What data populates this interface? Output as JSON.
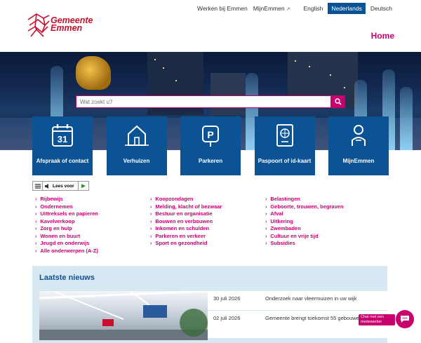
{
  "header": {
    "logo_line1": "Gemeente",
    "logo_line2": "Emmen",
    "links": {
      "werken": "Werken bij Emmen",
      "mijn": "MijnEmmen"
    },
    "languages": [
      "English",
      "Nederlands",
      "Deutsch"
    ],
    "active_language": "Nederlands",
    "home": "Home"
  },
  "search": {
    "placeholder": "Wat zoekt u?"
  },
  "tiles": [
    {
      "label": "Afspraak of contact",
      "icon": "calendar-icon",
      "icon_text": "31"
    },
    {
      "label": "Verhuizen",
      "icon": "house-icon"
    },
    {
      "label": "Parkeren",
      "icon": "parking-icon",
      "icon_text": "P"
    },
    {
      "label": "Paspoort of id-kaart",
      "icon": "passport-icon"
    },
    {
      "label": "MijnEmmen",
      "icon": "person-icon"
    }
  ],
  "reader": {
    "label": "Lees voor"
  },
  "links": {
    "col1": [
      "Rijbewijs",
      "Ondernemen",
      "Uittreksels en papieren",
      "Kavelverkoop",
      "Zorg en hulp",
      "Wonen en buurt",
      "Jeugd en onderwijs",
      "Alle onderwerpen (A-Z)"
    ],
    "col2": [
      "Koopzondagen",
      "Melding, klacht of bezwaar",
      "Bestuur en organisatie",
      "Bouwen en verbouwen",
      "Inkomen en schulden",
      "Parkeren en verkeer",
      "Sport en gezondheid"
    ],
    "col3": [
      "Belastingen",
      "Geboorte, trouwen, begraven",
      "Afval",
      "Uitkering",
      "Zwembaden",
      "Cultuur en vrije tijd",
      "Subsidies"
    ]
  },
  "news": {
    "title": "Laatste nieuws",
    "items": [
      {
        "date": "30 juli 2026",
        "title": "Onderzoek naar vleermuizen in uw wijk"
      },
      {
        "date": "02 juli 2026",
        "title": "Gemeente brengt toekomst 55 gebouwen in kaart"
      }
    ]
  },
  "chat": {
    "label": "Chat met een medewerker"
  },
  "colors": {
    "brand_red": "#c8102e",
    "accent_magenta": "#c8006e",
    "tile_blue": "#0b5394",
    "news_bg": "#d8e8f2"
  }
}
